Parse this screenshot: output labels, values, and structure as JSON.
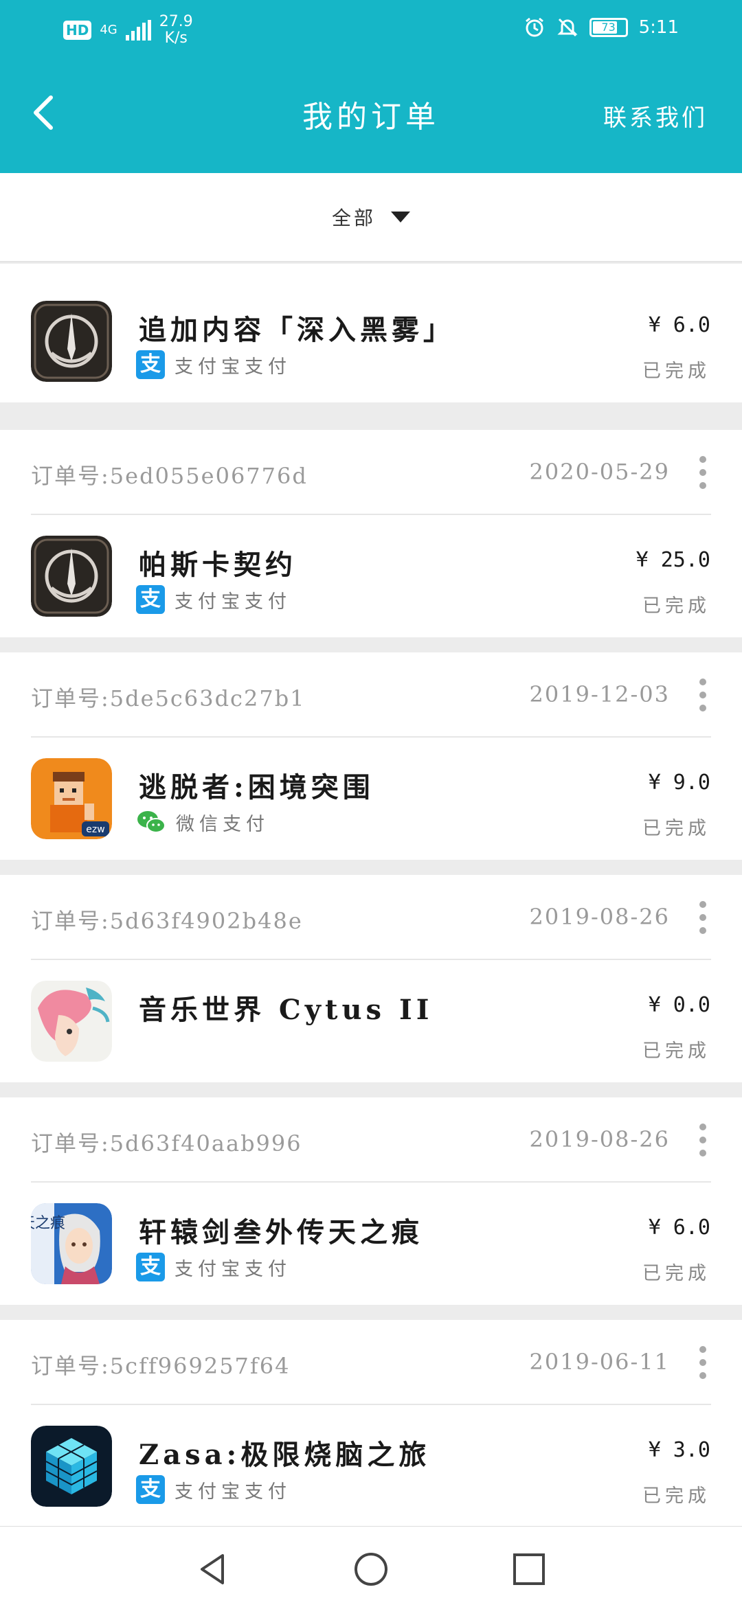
{
  "status_bar": {
    "hd": "HD",
    "network": "4G",
    "speed_value": "27.9",
    "speed_unit": "K/s",
    "battery": "73",
    "time": "5:11"
  },
  "header": {
    "title": "我的订单",
    "contact": "联系我们"
  },
  "filter": {
    "label": "全部"
  },
  "orders": [
    {
      "order_no": "",
      "date": "",
      "product": "追加内容「深入黑雾」",
      "payment": "支付宝支付",
      "payment_type": "alipay",
      "price": "¥ 6.0",
      "status": "已完成",
      "icon": "dark-rune-icon"
    },
    {
      "order_no": "订单号:5ed055e06776d",
      "date": "2020-05-29",
      "product": "帕斯卡契约",
      "payment": "支付宝支付",
      "payment_type": "alipay",
      "price": "¥ 25.0",
      "status": "已完成",
      "icon": "dark-rune-icon"
    },
    {
      "order_no": "订单号:5de5c63dc27b1",
      "date": "2019-12-03",
      "product": "逃脱者:困境突围",
      "payment": "微信支付",
      "payment_type": "wechat",
      "price": "¥ 9.0",
      "status": "已完成",
      "icon": "pixel-prisoner-icon"
    },
    {
      "order_no": "订单号:5d63f4902b48e",
      "date": "2019-08-26",
      "product": "音乐世界 Cytus II",
      "payment": "",
      "payment_type": "none",
      "price": "¥ 0.0",
      "status": "已完成",
      "icon": "pink-hair-girl-icon"
    },
    {
      "order_no": "订单号:5d63f40aab996",
      "date": "2019-08-26",
      "product": "轩辕剑叁外传天之痕",
      "payment": "支付宝支付",
      "payment_type": "alipay",
      "price": "¥ 6.0",
      "status": "已完成",
      "icon": "heroine-portrait-icon"
    },
    {
      "order_no": "订单号:5cff969257f64",
      "date": "2019-06-11",
      "product": "Zasa:极限烧脑之旅",
      "payment": "支付宝支付",
      "payment_type": "alipay",
      "price": "¥ 3.0",
      "status": "已完成",
      "icon": "blue-cube-icon"
    }
  ],
  "app_icon_text": {
    "ezw": "ezw",
    "tianzhihen": "天之痕"
  },
  "colors": {
    "header_bg": "#16b6c7",
    "alipay": "#1a9ae8",
    "wechat": "#3bb34a"
  }
}
